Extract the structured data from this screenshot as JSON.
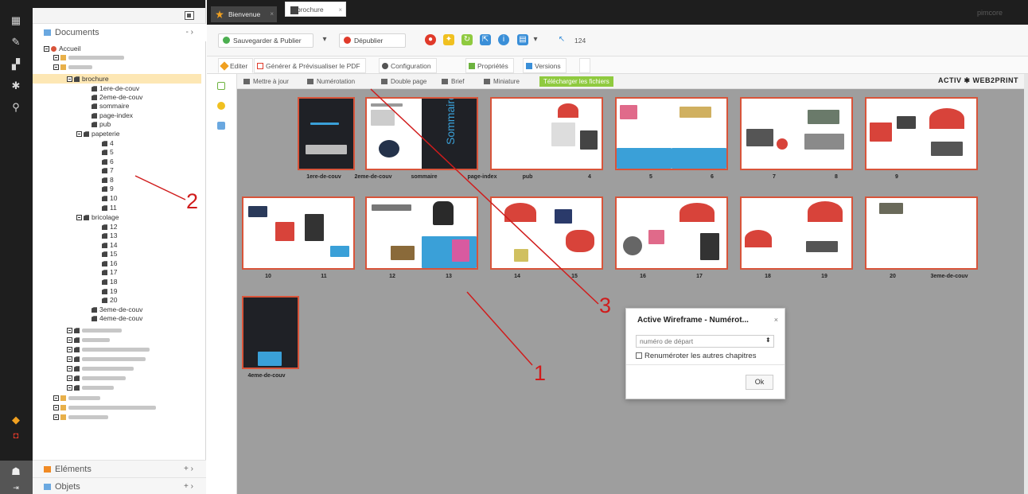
{
  "tabs": [
    {
      "label": "Bienvenue"
    },
    {
      "label": "brochure"
    }
  ],
  "brand": "pimcore",
  "tree": {
    "root_label": "Documents",
    "root_controls": "- ›",
    "nodes": {
      "accueil": "Accueil",
      "brochure": "brochure",
      "p1": "1ere-de-couv",
      "p2": "2eme-de-couv",
      "p3": "sommaire",
      "p4": "page-index",
      "p5": "pub",
      "papeterie": "papeterie",
      "n4": "4",
      "n5": "5",
      "n6": "6",
      "n7": "7",
      "n8": "8",
      "n9": "9",
      "n10": "10",
      "n11": "11",
      "bricolage": "bricolage",
      "n12": "12",
      "n13": "13",
      "n14": "14",
      "n15": "15",
      "n16": "16",
      "n17": "17",
      "n18": "18",
      "n19": "19",
      "n20": "20",
      "p3c": "3eme-de-couv",
      "p4c": "4eme-de-couv"
    },
    "bottom": [
      {
        "label": "Eléments",
        "controls": "+ ›"
      },
      {
        "label": "Objets",
        "controls": "+ ›"
      }
    ]
  },
  "toolbar": {
    "save_publish": "Sauvegarder & Publier",
    "unpublish": "Dépublier",
    "id_value": "124"
  },
  "doc_tabs": {
    "edit": "Editer",
    "generate": "Générer & Prévisualiser le PDF",
    "config": "Configuration",
    "props": "Propriétés",
    "versions": "Versions"
  },
  "subbar": {
    "update": "Mettre à jour",
    "numbering": "Numérotation",
    "double": "Double page",
    "brief": "Brief",
    "thumb": "Miniature",
    "download": "Télécharger les fichiers",
    "logo": "ACTIV ✱ WEB2PRINT"
  },
  "page_labels": {
    "r1": [
      "1ere-de-couv",
      "2eme-de-couv",
      "sommaire",
      "page-index",
      "pub",
      "4",
      "5",
      "6",
      "7",
      "8",
      "9"
    ],
    "r2": [
      "10",
      "11",
      "12",
      "13",
      "14",
      "15",
      "16",
      "17",
      "18",
      "19",
      "20",
      "3eme-de-couv"
    ],
    "r3": [
      "4eme-de-couv"
    ]
  },
  "cover_text": "Sommaire",
  "modal": {
    "title": "Active Wireframe - Numérot...",
    "close": "×",
    "placeholder": "numéro de départ",
    "checkbox_label": "Renuméroter les autres chapitres",
    "ok": "Ok"
  },
  "annotations": {
    "a1": "1",
    "a2": "2",
    "a3": "3"
  },
  "colors": {
    "accent_orange": "#f0a020",
    "annotation_red": "#d01c1c",
    "download_green": "#8fca3f",
    "page_border": "#d8543a"
  }
}
